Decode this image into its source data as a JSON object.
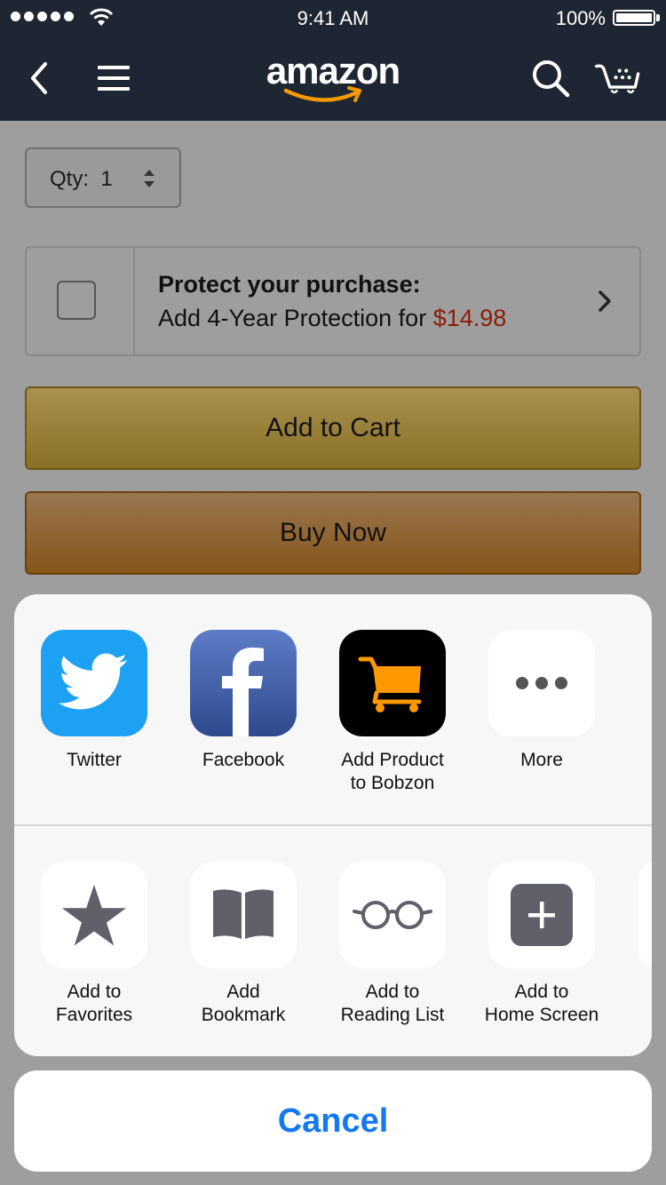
{
  "status_bar": {
    "time": "9:41 AM",
    "battery": "100%"
  },
  "nav": {
    "logo": "amazon",
    "icons": [
      "back-icon",
      "menu-icon",
      "search-icon",
      "cart-icon"
    ]
  },
  "product": {
    "qty_label": "Qty:",
    "qty_value": "1",
    "protect_title": "Protect your purchase:",
    "protect_text": "Add 4-Year Protection for",
    "protect_price": "$14.98",
    "add_to_cart": "Add to Cart",
    "buy_now": "Buy Now"
  },
  "share_sheet": {
    "apps": [
      {
        "label": "Twitter",
        "icon": "twitter-icon",
        "color": "#1da1f2"
      },
      {
        "label": "Facebook",
        "icon": "facebook-icon",
        "color": "#3b5998"
      },
      {
        "label": "Add Product\nto Bobzon",
        "icon": "shopping-cart-icon",
        "color": "#000000"
      },
      {
        "label": "More",
        "icon": "more-icon",
        "color": "#ffffff"
      }
    ],
    "actions": [
      {
        "label": "Add to\nFavorites",
        "icon": "star-icon"
      },
      {
        "label": "Add\nBookmark",
        "icon": "book-icon"
      },
      {
        "label": "Add to\nReading List",
        "icon": "glasses-icon"
      },
      {
        "label": "Add to\nHome Screen",
        "icon": "plus-square-icon"
      }
    ],
    "cancel": "Cancel"
  },
  "colors": {
    "nav_bg": "#1e2633",
    "price_red": "#8b1c08",
    "ios_blue": "#1479f0",
    "bobzon_orange": "#ff9900"
  }
}
